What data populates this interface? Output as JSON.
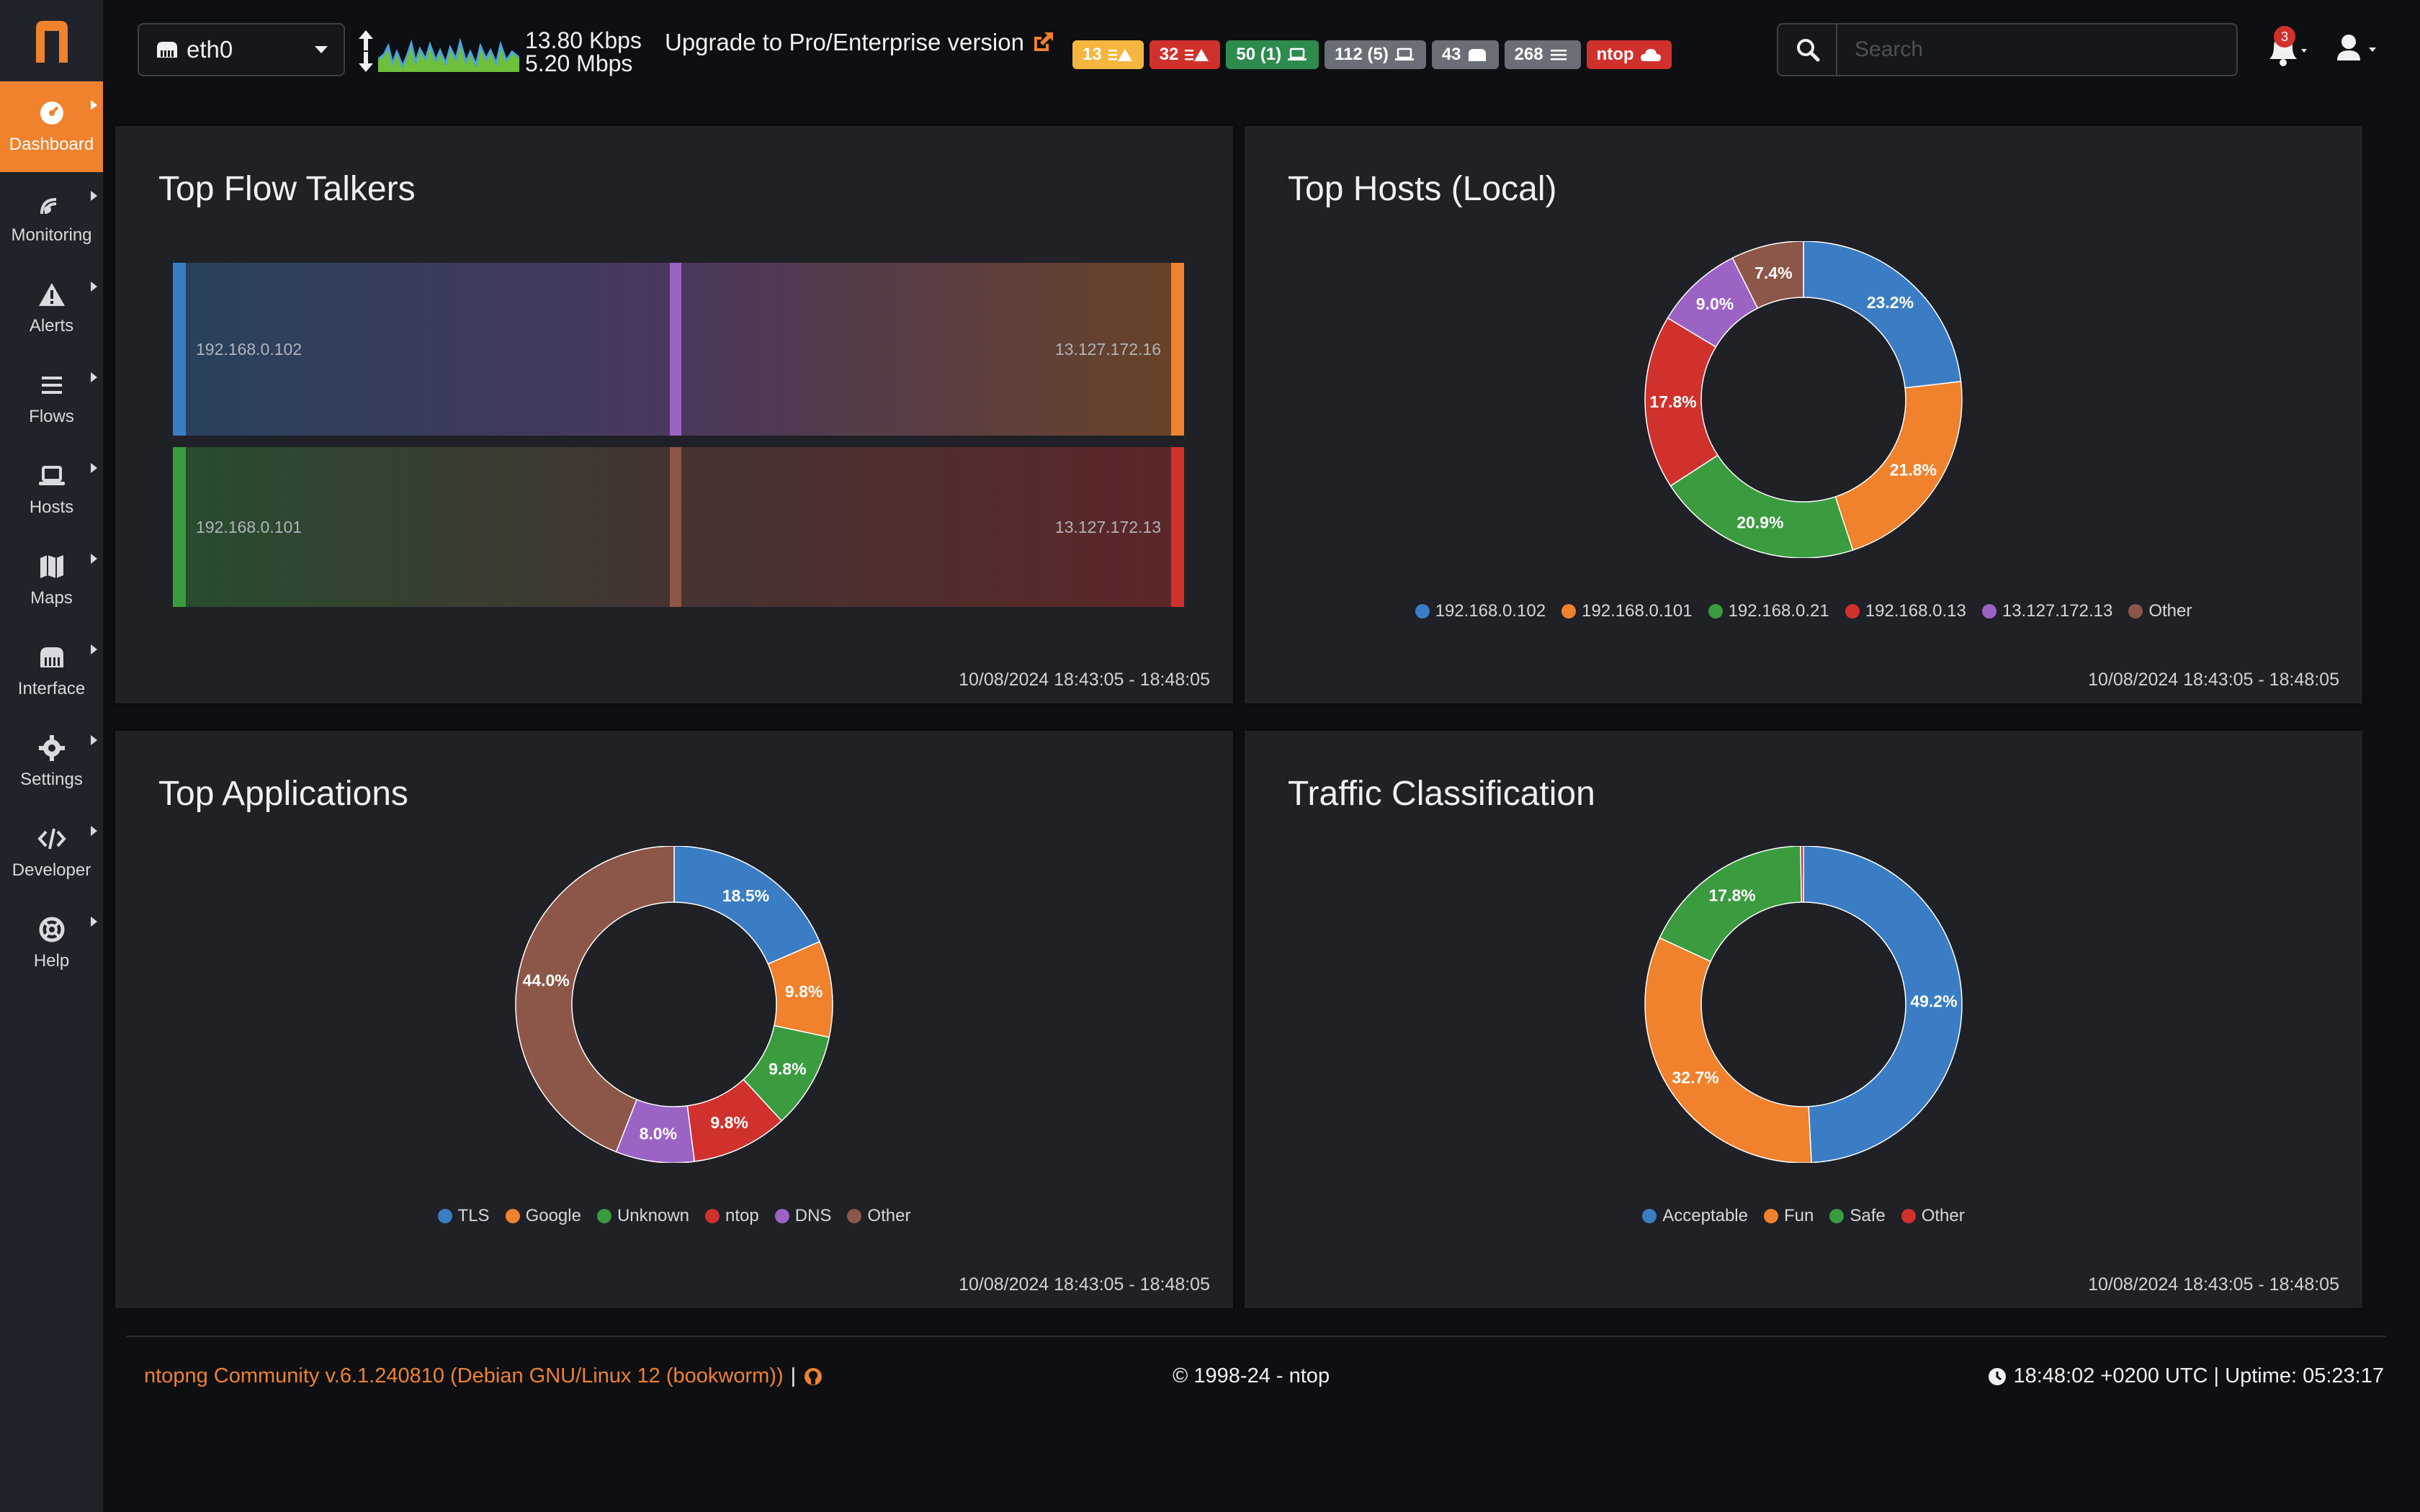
{
  "sidebar": {
    "logo": "n",
    "items": [
      {
        "label": "Dashboard",
        "icon": "gauge-icon"
      },
      {
        "label": "Monitoring",
        "icon": "radar-icon"
      },
      {
        "label": "Alerts",
        "icon": "warning-icon"
      },
      {
        "label": "Flows",
        "icon": "list-icon"
      },
      {
        "label": "Hosts",
        "icon": "laptop-icon"
      },
      {
        "label": "Maps",
        "icon": "map-icon"
      },
      {
        "label": "Interface",
        "icon": "ethernet-icon"
      },
      {
        "label": "Settings",
        "icon": "gear-icon"
      },
      {
        "label": "Developer",
        "icon": "code-icon"
      },
      {
        "label": "Help",
        "icon": "lifebuoy-icon"
      }
    ]
  },
  "topbar": {
    "interface": "eth0",
    "rate_up": "13.80 Kbps",
    "rate_down": "5.20 Mbps",
    "upgrade": "Upgrade to Pro/Enterprise version",
    "search_placeholder": "Search",
    "notification_count": "3",
    "badges": [
      {
        "text": "13",
        "color": "#f4b63f",
        "icon": "list-warning-icon"
      },
      {
        "text": "32",
        "color": "#d0312d",
        "icon": "list-warning-icon"
      },
      {
        "text": "50 (1)",
        "color": "#2e8b4e",
        "icon": "laptop-icon"
      },
      {
        "text": "112 (5)",
        "color": "#6a6f77",
        "icon": "laptop-icon"
      },
      {
        "text": "43",
        "color": "#6a6f77",
        "icon": "ethernet-icon"
      },
      {
        "text": "268",
        "color": "#6a6f77",
        "icon": "list-icon"
      },
      {
        "text": "ntop",
        "color": "#d0312d",
        "icon": "cloud-icon"
      }
    ]
  },
  "cards": {
    "flow_talkers": {
      "title": "Top Flow Talkers",
      "time": "10/08/2024 18:43:05 - 18:48:05",
      "flows": [
        {
          "src": "192.168.0.102",
          "dst": "13.127.172.16",
          "src_color": "#3a7dc4",
          "dst_color": "#f0812d",
          "mid_color": "#9b63c4"
        },
        {
          "src": "192.168.0.101",
          "dst": "13.127.172.13",
          "src_color": "#3a9b3f",
          "dst_color": "#d0312d",
          "mid_color": "#8c5648"
        }
      ]
    },
    "top_hosts": {
      "title": "Top Hosts (Local)",
      "time": "10/08/2024 18:43:05 - 18:48:05"
    },
    "top_apps": {
      "title": "Top Applications",
      "time": "10/08/2024 18:43:05 - 18:48:05"
    },
    "traffic_class": {
      "title": "Traffic Classification",
      "time": "10/08/2024 18:43:05 - 18:48:05"
    }
  },
  "chart_data": [
    {
      "type": "pie",
      "title": "Top Hosts (Local)",
      "categories": [
        "192.168.0.102",
        "192.168.0.101",
        "192.168.0.21",
        "192.168.0.13",
        "13.127.172.13",
        "Other"
      ],
      "values": [
        23.2,
        21.8,
        20.9,
        17.8,
        9.0,
        7.4
      ],
      "labels": [
        "23.2%",
        "21.8%",
        "20.9%",
        "17.8%",
        "9.0%",
        "7.4%"
      ],
      "colors": [
        "#3a7dc4",
        "#f0812d",
        "#3a9b3f",
        "#d0312d",
        "#9b63c4",
        "#8c5648"
      ],
      "legend": "bottom"
    },
    {
      "type": "pie",
      "title": "Top Applications",
      "categories": [
        "TLS",
        "Google",
        "Unknown",
        "ntop",
        "DNS",
        "Other"
      ],
      "values": [
        18.5,
        9.8,
        9.8,
        9.8,
        8.0,
        44.0
      ],
      "labels": [
        "18.5%",
        "9.8%",
        "9.8%",
        "9.8%",
        "8.0%",
        "44.0%"
      ],
      "colors": [
        "#3a7dc4",
        "#f0812d",
        "#3a9b3f",
        "#d0312d",
        "#9b63c4",
        "#8c5648"
      ],
      "legend": "bottom"
    },
    {
      "type": "pie",
      "title": "Traffic Classification",
      "categories": [
        "Acceptable",
        "Fun",
        "Safe",
        "Other"
      ],
      "values": [
        49.2,
        32.7,
        17.8,
        0.3
      ],
      "labels": [
        "49.2%",
        "32.7%",
        "17.8%",
        ""
      ],
      "colors": [
        "#3a7dc4",
        "#f0812d",
        "#3a9b3f",
        "#d0312d"
      ],
      "legend": "bottom"
    }
  ],
  "footer": {
    "version": "ntopng Community v.6.1.240810 (Debian GNU/Linux 12 (bookworm))",
    "separator": "|",
    "copyright": "© 1998-24 - ntop",
    "status": "18:48:02 +0200 UTC | Uptime: 05:23:17"
  },
  "colors": {
    "accent": "#f0812d",
    "sidebar_bg": "#202329",
    "card_bg": "#1f2126"
  }
}
